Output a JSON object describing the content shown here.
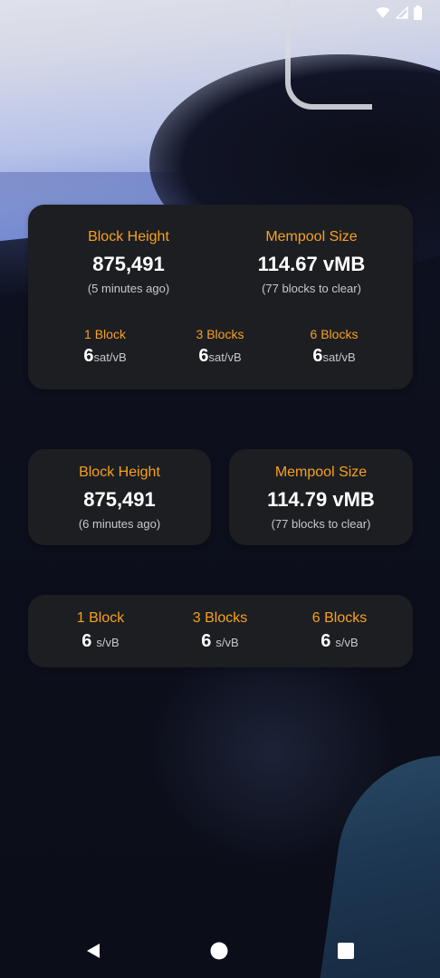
{
  "status_bar": {
    "icons": [
      "wifi-icon",
      "cell-signal-icon",
      "battery-icon"
    ]
  },
  "widget_large": {
    "block_height": {
      "label": "Block Height",
      "value": "875,491",
      "sub": "(5 minutes ago)"
    },
    "mempool": {
      "label": "Mempool Size",
      "value": "114.67 vMB",
      "sub": "(77 blocks to clear)"
    },
    "fees": [
      {
        "label": "1 Block",
        "value": "6",
        "unit": "sat/vB"
      },
      {
        "label": "3 Blocks",
        "value": "6",
        "unit": "sat/vB"
      },
      {
        "label": "6 Blocks",
        "value": "6",
        "unit": "sat/vB"
      }
    ]
  },
  "widget_block_height": {
    "label": "Block Height",
    "value": "875,491",
    "sub": "(6 minutes ago)"
  },
  "widget_mempool": {
    "label": "Mempool Size",
    "value": "114.79 vMB",
    "sub": "(77 blocks to clear)"
  },
  "widget_fees": {
    "fees": [
      {
        "label": "1 Block",
        "value": "6",
        "unit": "s/vB"
      },
      {
        "label": "3 Blocks",
        "value": "6",
        "unit": "s/vB"
      },
      {
        "label": "6 Blocks",
        "value": "6",
        "unit": "s/vB"
      }
    ]
  },
  "nav_bar": {
    "buttons": [
      "back-icon",
      "home-icon",
      "recents-icon"
    ]
  },
  "colors": {
    "accent": "#f7a11f",
    "card_bg": "#1d1e22",
    "text": "#ffffff"
  }
}
